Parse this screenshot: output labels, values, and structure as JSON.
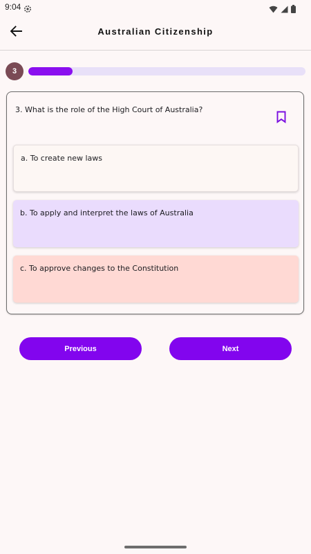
{
  "status_bar": {
    "time": "9:04",
    "icons": [
      "settings-gear-icon",
      "wifi-icon",
      "cellular-icon",
      "battery-icon"
    ]
  },
  "app_bar": {
    "back_icon": "arrow-left-icon",
    "title": "Australian Citizenship"
  },
  "progress": {
    "step": "3",
    "fraction": 0.16,
    "fill_color": "#8a0fef",
    "track_color": "#e8e0f8"
  },
  "question": {
    "text": "3. What is the role of the High Court of Australia?",
    "bookmark_icon": "bookmark-outline-icon",
    "options": [
      {
        "label": "a. To create new laws",
        "state": "default",
        "color": "#fdf7f4"
      },
      {
        "label": "b. To apply and interpret the laws of Australia",
        "state": "correct",
        "color": "#eadcfd"
      },
      {
        "label": "c. To approve changes to the Constitution",
        "state": "incorrect",
        "color": "#ffd9d4"
      }
    ]
  },
  "navigation": {
    "previous_label": "Previous",
    "next_label": "Next",
    "button_color": "#8205ee"
  }
}
